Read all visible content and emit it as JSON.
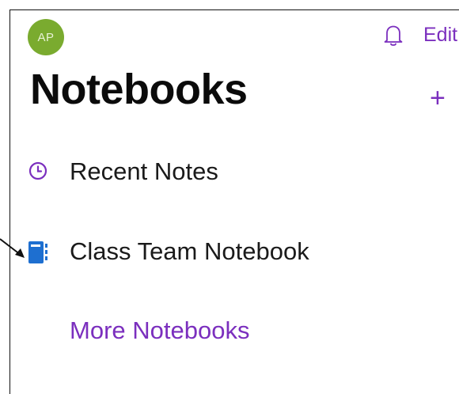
{
  "header": {
    "avatar_initials": "AP",
    "edit_label": "Edit",
    "title": "Notebooks"
  },
  "list": {
    "recent_notes_label": "Recent Notes",
    "notebook_label": "Class Team Notebook",
    "more_label": "More Notebooks"
  },
  "colors": {
    "accent": "#7b2fbe",
    "avatar": "#7aab2f",
    "notebook_icon": "#1e6fd0"
  },
  "icons": [
    "bell-icon",
    "plus-icon",
    "clock-icon",
    "notebook-icon",
    "pointer-arrow-icon"
  ]
}
